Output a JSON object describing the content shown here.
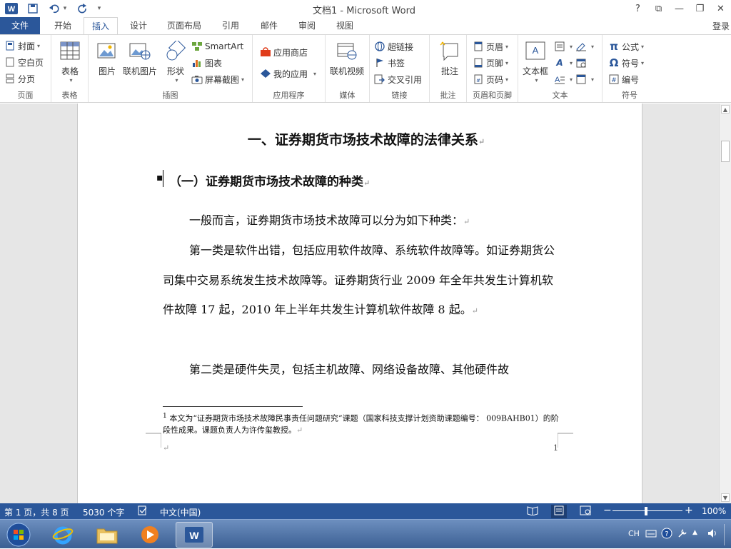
{
  "title_bar": {
    "doc_title": "文档1 - Microsoft Word",
    "app_icon_letter": "W",
    "undo_dropdown": "▾",
    "customize_qat": "▾",
    "window_buttons": [
      "?",
      "⧉",
      "—",
      "❐",
      "✕"
    ]
  },
  "tabs": {
    "file": "文件",
    "items": [
      "开始",
      "插入",
      "设计",
      "页面布局",
      "引用",
      "邮件",
      "审阅",
      "视图"
    ],
    "active": "插入",
    "login": "登录"
  },
  "ribbon": {
    "pages": {
      "label": "页面",
      "cover": "封面",
      "blank": "空白页",
      "break": "分页"
    },
    "tables": {
      "label": "表格",
      "table": "表格"
    },
    "illustrations": {
      "label": "插图",
      "picture": "图片",
      "online_picture": "联机图片",
      "shapes": "形状",
      "smartart": "SmartArt",
      "chart": "图表",
      "screenshot": "屏幕截图"
    },
    "apps": {
      "label": "应用程序",
      "store": "应用商店",
      "my_apps": "我的应用"
    },
    "media": {
      "label": "媒体",
      "online_video": "联机视频"
    },
    "links": {
      "label": "链接",
      "hyperlink": "超链接",
      "bookmark": "书签",
      "cross_ref": "交叉引用"
    },
    "comments": {
      "label": "批注",
      "comment": "批注"
    },
    "header_footer": {
      "label": "页眉和页脚",
      "header": "页眉",
      "footer": "页脚",
      "page_number": "页码"
    },
    "text": {
      "label": "文本",
      "textbox": "文本框"
    },
    "symbols": {
      "label": "符号",
      "equation": "公式",
      "symbol": "符号",
      "number": "编号"
    }
  },
  "document": {
    "heading1": "一、证券期货市场技术故障的法律关系",
    "heading2": "（一）证券期货市场技术故障的种类",
    "paragraphs": [
      "一般而言，证券期货市场技术故障可以分为如下种类：",
      "第一类是软件出错，包括应用软件故障、系统软件故障等。如证券期货公司集中交易系统发生技术故障等。证券期货行业 2009 年全年共发生计算机软件故障 17 起，2010 年上半年共发生计算机软件故障 8 起。",
      "第二类是硬件失灵，包括主机故障、网络设备故障、其他硬件故"
    ],
    "footnote_mark": "1",
    "footnote": " 本文为“证券期货市场技术故障民事责任问题研究”课题（国家科技支撑计划资助课题编号： 009BAHB01）的阶段性成果。课题负责人为许传玺教授。",
    "page_number": "1",
    "return_mark": "↵"
  },
  "status_bar": {
    "page": "第 1 页，共 8 页",
    "words": "5030 个字",
    "language": "中文(中国)",
    "zoom": "100%",
    "zoom_minus": "−",
    "zoom_plus": "+"
  },
  "taskbar": {
    "ime": "CH"
  },
  "colors": {
    "accent": "#2b579a"
  }
}
